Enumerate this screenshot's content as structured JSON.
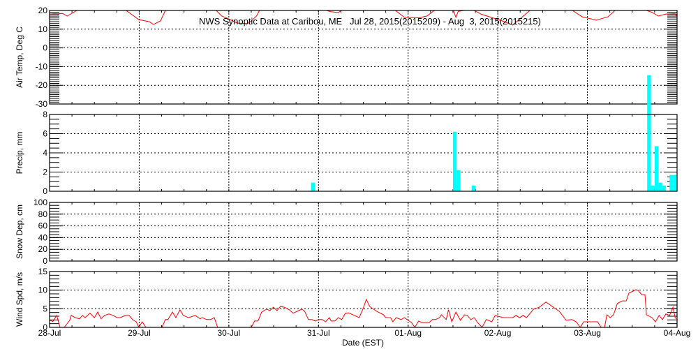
{
  "chart_data": {
    "type": "line",
    "title": "NWS Synoptic Data at Caribou, ME   Jul 28, 2015(2015209) - Aug  3, 2015(2015215)",
    "xlabel": "Date (EST)",
    "x_unit": "hours since 28-Jul 00:00",
    "xlim": [
      0,
      168
    ],
    "x_ticks": [
      {
        "hour": 0,
        "label": "28-Jul"
      },
      {
        "hour": 24,
        "label": "29-Jul"
      },
      {
        "hour": 48,
        "label": "30-Jul"
      },
      {
        "hour": 72,
        "label": "31-Jul"
      },
      {
        "hour": 96,
        "label": "01-Aug"
      },
      {
        "hour": 120,
        "label": "02-Aug"
      },
      {
        "hour": 144,
        "label": "03-Aug"
      },
      {
        "hour": 168,
        "label": "04-Aug"
      }
    ],
    "grid": true,
    "colors": {
      "line": "#ff0000",
      "bar": "#00ffff",
      "axis": "#000000"
    },
    "panels": [
      {
        "id": "temp",
        "ylabel": "Air Temp, Deg C",
        "type": "line",
        "ylim": [
          -30,
          20
        ],
        "yticks": [
          -30,
          -20,
          -10,
          0,
          10,
          20
        ],
        "minor_step": 1,
        "points": [
          [
            0,
            18.1
          ],
          [
            1.1,
            18.3
          ],
          [
            2.2,
            18.2
          ],
          [
            3.5,
            18.4
          ],
          [
            4.7,
            17.0
          ],
          [
            6,
            18.5
          ],
          [
            7.3,
            20
          ],
          [
            14,
            26
          ],
          [
            20.5,
            20
          ],
          [
            23.9,
            15.1
          ],
          [
            26.7,
            14.0
          ],
          [
            27.8,
            12.5
          ],
          [
            29.7,
            14.4
          ],
          [
            31,
            20
          ],
          [
            38,
            27
          ],
          [
            44.6,
            20
          ],
          [
            46.1,
            17
          ],
          [
            48.4,
            15.1
          ],
          [
            50.2,
            13.3
          ],
          [
            53,
            12.9
          ],
          [
            54,
            14.4
          ],
          [
            55.4,
            17
          ],
          [
            56.2,
            20
          ],
          [
            65,
            25
          ],
          [
            74.1,
            20
          ],
          [
            75.4,
            19.3
          ],
          [
            77.3,
            18.9
          ],
          [
            78.2,
            20
          ],
          [
            86,
            24
          ],
          [
            92.6,
            20
          ],
          [
            95,
            16.3
          ],
          [
            98.8,
            16.1
          ],
          [
            101,
            17
          ],
          [
            103,
            20
          ],
          [
            105.5,
            21
          ],
          [
            108.1,
            20
          ],
          [
            108.8,
            16.3
          ],
          [
            109.4,
            19.5
          ],
          [
            111,
            20
          ],
          [
            112.5,
            21
          ],
          [
            113.7,
            20
          ],
          [
            115.6,
            18
          ],
          [
            121.2,
            14.4
          ],
          [
            124,
            12.2
          ],
          [
            128.6,
            20
          ],
          [
            135,
            25
          ],
          [
            140,
            20
          ],
          [
            142.6,
            16.6
          ],
          [
            146.4,
            14.8
          ],
          [
            149.5,
            16.6
          ],
          [
            151.4,
            20
          ],
          [
            156,
            23
          ],
          [
            159.8,
            20
          ],
          [
            161.3,
            19
          ],
          [
            163,
            17
          ],
          [
            165,
            18.1
          ],
          [
            167.5,
            18.3
          ],
          [
            167.8,
            17.2
          ]
        ]
      },
      {
        "id": "precip",
        "ylabel": "Precip, mm",
        "type": "bar",
        "ylim": [
          0,
          8
        ],
        "yticks": [
          0,
          2,
          4,
          6,
          8
        ],
        "minor_step": 0.5,
        "bars": [
          [
            70,
            0.9
          ],
          [
            108,
            6.2
          ],
          [
            109,
            2.2
          ],
          [
            113,
            0.6
          ],
          [
            160,
            12.1
          ],
          [
            161,
            0.6
          ],
          [
            162,
            4.7
          ],
          [
            163,
            0.9
          ],
          [
            164,
            0.6
          ],
          [
            166,
            1.7
          ],
          [
            167,
            1.7
          ]
        ]
      },
      {
        "id": "snow",
        "ylabel": "Snow Dep, cm",
        "type": "line",
        "ylim": [
          0,
          100
        ],
        "yticks": [
          0,
          20,
          40,
          60,
          80,
          100
        ],
        "minor_step": 5,
        "points": []
      },
      {
        "id": "wind",
        "ylabel": "Wind Spd, m/s",
        "type": "line",
        "ylim": [
          0,
          15
        ],
        "yticks": [
          0,
          5,
          10,
          15
        ],
        "minor_step": 1,
        "points": [
          [
            0,
            1.9
          ],
          [
            0.9,
            1.6
          ],
          [
            1.9,
            3.2
          ],
          [
            2.8,
            0
          ],
          [
            3.9,
            0
          ],
          [
            5.4,
            1.9
          ],
          [
            5.8,
            3.2
          ],
          [
            6.9,
            2.6
          ],
          [
            8.0,
            2.3
          ],
          [
            8.8,
            3.2
          ],
          [
            9.5,
            2.6
          ],
          [
            10.8,
            3.8
          ],
          [
            12.0,
            2.6
          ],
          [
            12.9,
            4.1
          ],
          [
            13.8,
            2.3
          ],
          [
            14.7,
            3.2
          ],
          [
            15.9,
            3.6
          ],
          [
            17.0,
            3.2
          ],
          [
            18.1,
            2.6
          ],
          [
            18.9,
            2.6
          ],
          [
            20.3,
            3.2
          ],
          [
            21.3,
            3.2
          ],
          [
            22.2,
            2.1
          ],
          [
            23.2,
            1.5
          ],
          [
            23.9,
            0
          ],
          [
            24.8,
            1.5
          ],
          [
            25.8,
            0
          ],
          [
            30.1,
            0
          ],
          [
            31.0,
            2.1
          ],
          [
            31.7,
            2.1
          ],
          [
            32.9,
            4.1
          ],
          [
            33.8,
            2.6
          ],
          [
            34.9,
            4.7
          ],
          [
            35.8,
            3.2
          ],
          [
            37.2,
            2.6
          ],
          [
            39.0,
            3.2
          ],
          [
            40.3,
            2.3
          ],
          [
            40.9,
            2.6
          ],
          [
            42.0,
            2.1
          ],
          [
            43.1,
            2.1
          ],
          [
            44.1,
            2.6
          ],
          [
            45.0,
            0
          ],
          [
            54.0,
            0
          ],
          [
            54.9,
            1.7
          ],
          [
            55.8,
            1.7
          ],
          [
            56.8,
            4.1
          ],
          [
            58.1,
            4.9
          ],
          [
            59.0,
            4.5
          ],
          [
            59.9,
            5.4
          ],
          [
            60.9,
            4.5
          ],
          [
            61.8,
            5.6
          ],
          [
            62.9,
            5.4
          ],
          [
            64.2,
            4.7
          ],
          [
            65.2,
            3.8
          ],
          [
            66.7,
            4.5
          ],
          [
            67.6,
            4.9
          ],
          [
            68.3,
            4.3
          ],
          [
            69.3,
            2.1
          ],
          [
            70.2,
            2.1
          ],
          [
            71.1,
            1.7
          ],
          [
            72.1,
            2.1
          ],
          [
            73.0,
            2.1
          ],
          [
            73.9,
            1.5
          ],
          [
            74.9,
            2.6
          ],
          [
            75.4,
            1.7
          ],
          [
            76.4,
            1.7
          ],
          [
            77.3,
            2.6
          ],
          [
            78.2,
            2.1
          ],
          [
            79.2,
            3.8
          ],
          [
            80.1,
            3.9
          ],
          [
            82.9,
            2.6
          ],
          [
            84.0,
            5.2
          ],
          [
            84.8,
            7.5
          ],
          [
            85.7,
            5.6
          ],
          [
            87.6,
            4.3
          ],
          [
            89.4,
            3.4
          ],
          [
            90.0,
            2.6
          ],
          [
            91.3,
            2.6
          ],
          [
            91.9,
            1.5
          ],
          [
            92.8,
            2.6
          ],
          [
            94.1,
            2.1
          ],
          [
            95.0,
            2.6
          ],
          [
            96.0,
            1.9
          ],
          [
            96.9,
            1.3
          ],
          [
            97.8,
            0
          ],
          [
            98.8,
            1.7
          ],
          [
            99.7,
            1.3
          ],
          [
            101.6,
            1.3
          ],
          [
            102.5,
            2.1
          ],
          [
            103.4,
            2.1
          ],
          [
            104.4,
            2.6
          ],
          [
            104.9,
            3.4
          ],
          [
            106.2,
            2.1
          ],
          [
            106.8,
            4.7
          ],
          [
            107.7,
            1.5
          ],
          [
            108.8,
            4.1
          ],
          [
            110.0,
            1.9
          ],
          [
            111.1,
            3.4
          ],
          [
            111.8,
            3.2
          ],
          [
            112.8,
            2.1
          ],
          [
            113.7,
            2.6
          ],
          [
            114.6,
            1.3
          ],
          [
            115.8,
            0
          ],
          [
            116.9,
            2.1
          ],
          [
            118.4,
            1.5
          ],
          [
            119.3,
            3.2
          ],
          [
            121.5,
            2.6
          ],
          [
            124.0,
            2.6
          ],
          [
            124.9,
            3.2
          ],
          [
            125.8,
            2.6
          ],
          [
            126.8,
            3.2
          ],
          [
            127.7,
            2.6
          ],
          [
            129.6,
            4.9
          ],
          [
            131.1,
            5.4
          ],
          [
            132.9,
            6.8
          ],
          [
            135.2,
            5.2
          ],
          [
            136.5,
            4.3
          ],
          [
            138.3,
            1.9
          ],
          [
            139.8,
            2.1
          ],
          [
            141.0,
            1.5
          ],
          [
            142.1,
            0
          ],
          [
            143.0,
            1.5
          ],
          [
            146.7,
            1.5
          ],
          [
            147.7,
            0
          ],
          [
            148.6,
            0
          ],
          [
            149.2,
            3.4
          ],
          [
            150.1,
            2.6
          ],
          [
            151.0,
            3.4
          ],
          [
            152.0,
            6.4
          ],
          [
            153.3,
            7.1
          ],
          [
            154.4,
            7.1
          ],
          [
            155.1,
            9.2
          ],
          [
            157.0,
            10.1
          ],
          [
            157.6,
            9.9
          ],
          [
            158.5,
            8.8
          ],
          [
            159.4,
            8.8
          ],
          [
            159.8,
            3.4
          ],
          [
            161.3,
            2.6
          ],
          [
            162.2,
            1.5
          ],
          [
            163.2,
            3.2
          ],
          [
            164.1,
            2.1
          ],
          [
            165.0,
            3.6
          ],
          [
            166.0,
            3.2
          ],
          [
            166.9,
            5.4
          ],
          [
            167.5,
            2.6
          ],
          [
            167.8,
            2.3
          ]
        ]
      }
    ]
  }
}
